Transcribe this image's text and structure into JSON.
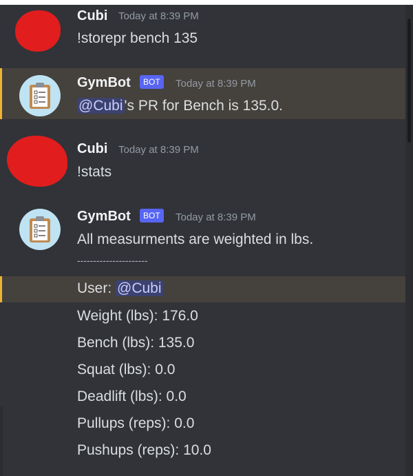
{
  "messages": [
    {
      "author": "Cubi",
      "timestamp": "Today at 8:39 PM",
      "content": "!storepr bench 135"
    },
    {
      "author": "GymBot",
      "tag": "BOT",
      "timestamp": "Today at 8:39 PM",
      "mention": "@Cubi",
      "content_suffix": "'s PR for Bench is 135.0."
    },
    {
      "author": "Cubi",
      "timestamp": "Today at 8:39 PM",
      "content": "!stats"
    },
    {
      "author": "GymBot",
      "tag": "BOT",
      "timestamp": "Today at 8:39 PM",
      "content": "All measurments are weighted in lbs."
    }
  ],
  "stats": {
    "divider": "----------------------",
    "user_label": "User: ",
    "user_mention": "@Cubi",
    "lines": [
      "Weight (lbs): 176.0",
      "Bench (lbs): 135.0",
      "Squat (lbs): 0.0",
      "Deadlift (lbs): 0.0",
      "Pullups (reps): 0.0",
      "Pushups (reps): 10.0"
    ]
  },
  "colors": {
    "background": "#313338",
    "highlight": "#45413c",
    "highlight_bar": "#f0b232",
    "bot_tag": "#5865f2",
    "mention": "#3c4270"
  },
  "icons": {
    "bot_avatar": "clipboard-icon",
    "user_avatar": "redacted-avatar"
  }
}
